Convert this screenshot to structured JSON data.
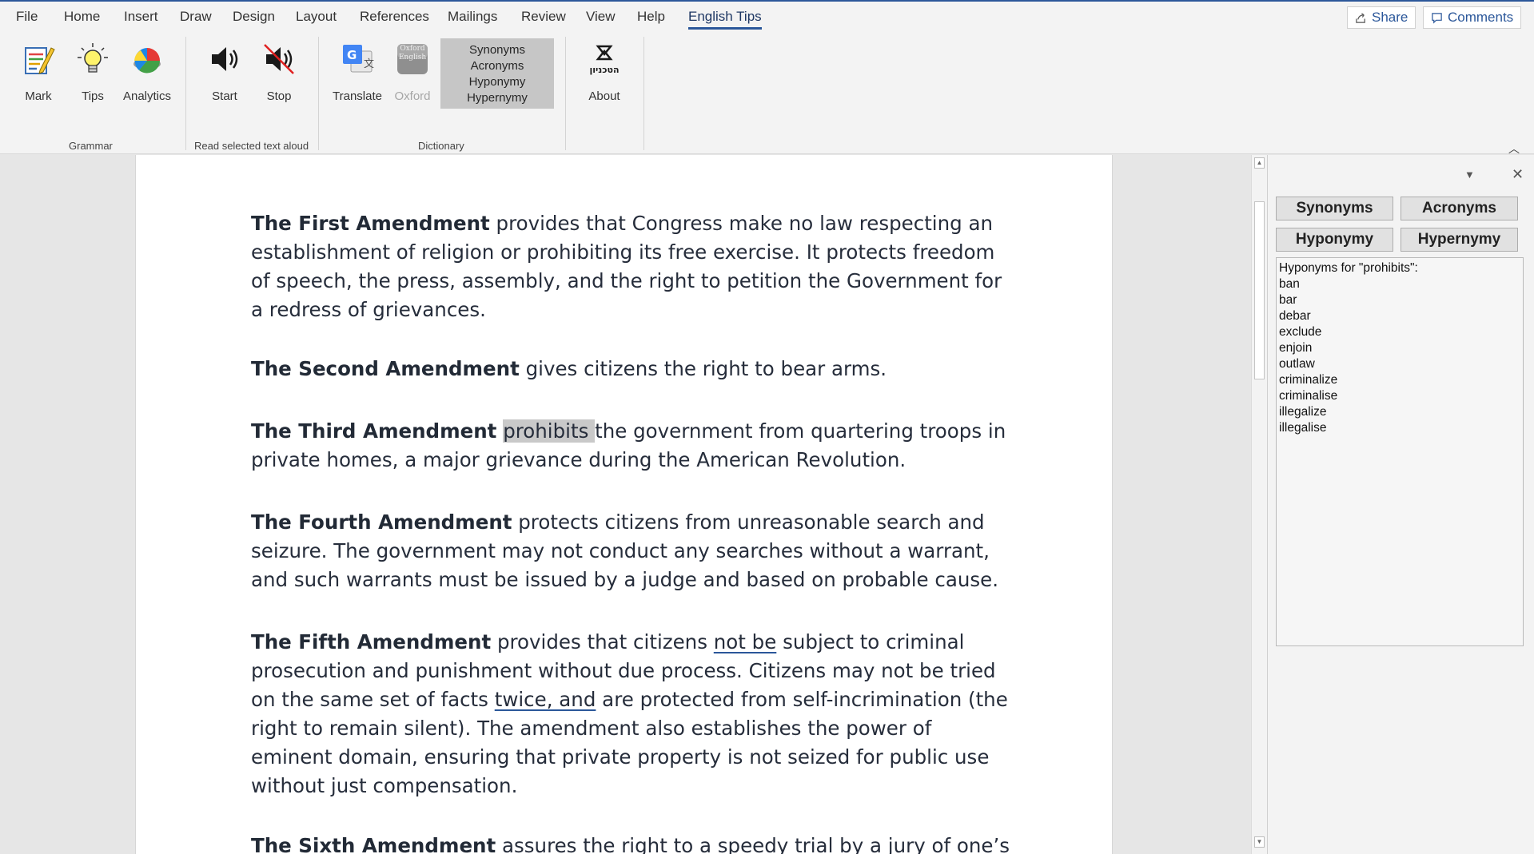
{
  "menu": {
    "tabs": [
      "File",
      "Home",
      "Insert",
      "Draw",
      "Design",
      "Layout",
      "References",
      "Mailings",
      "Review",
      "View",
      "Help",
      "English Tips"
    ],
    "active_tab": "English Tips",
    "share_label": "Share",
    "comments_label": "Comments"
  },
  "ribbon": {
    "grammar": {
      "mark": "Mark",
      "tips": "Tips",
      "analytics": "Analytics",
      "group_label": "Grammar"
    },
    "speech": {
      "start": "Start",
      "stop": "Stop",
      "group_label": "Read selected text aloud"
    },
    "dictionary": {
      "translate": "Translate",
      "oxford": "Oxford",
      "oxford_icon_text": "Oxford English",
      "options": [
        "Synonyms",
        "Acronyms",
        "Hyponymy",
        "Hypernymy"
      ],
      "group_label": "Dictionary"
    },
    "about": {
      "label": "About",
      "logo_text": "הטכניון"
    }
  },
  "document": {
    "p1": {
      "bold": "The First Amendment",
      "text": " provides that Congress make no law respecting an establishment of religion or prohibiting its free exercise. It protects freedom of speech, the press, assembly, and the right to petition the Government for a redress of grievances."
    },
    "p2": {
      "bold": "The Second Amendment",
      "text": " gives citizens the right to bear arms."
    },
    "p3": {
      "bold": "The Third Amendment",
      "highlight": "prohibits ",
      "text": "the government from quartering troops in private homes, a major grievance during the American Revolution."
    },
    "p4": {
      "bold": "The Fourth Amendment",
      "text": " protects citizens from unreasonable search and seizure. The government may not conduct any searches without a warrant, and such warrants must be issued by a judge and based on probable cause."
    },
    "p5": {
      "bold": "The Fifth Amendment",
      "t1": " provides that citizens ",
      "u1": "not be",
      "t2": " subject to criminal prosecution and punishment without due process. Citizens may not be tried on the same set of facts ",
      "u2": "twice, and",
      "t3": " are protected from self-incrimination (the right to remain silent). The amendment also establishes the power of eminent domain, ensuring that private property is not seized for public use without just compensation."
    },
    "p6": {
      "bold": "The Sixth Amendment",
      "text": " assures the right to a speedy trial by a jury of one’s"
    }
  },
  "pane": {
    "buttons": {
      "synonyms": "Synonyms",
      "acronyms": "Acronyms",
      "hyponymy": "Hyponymy",
      "hypernymy": "Hypernymy"
    },
    "results_title": "Hyponyms for \"prohibits\":",
    "results": [
      "ban",
      "bar",
      "debar",
      "exclude",
      "enjoin",
      "outlaw",
      "criminalize",
      "criminalise",
      "illegalize",
      "illegalise"
    ]
  },
  "colors": {
    "accent": "#2b579a",
    "highlight": "#c9c9c9"
  }
}
